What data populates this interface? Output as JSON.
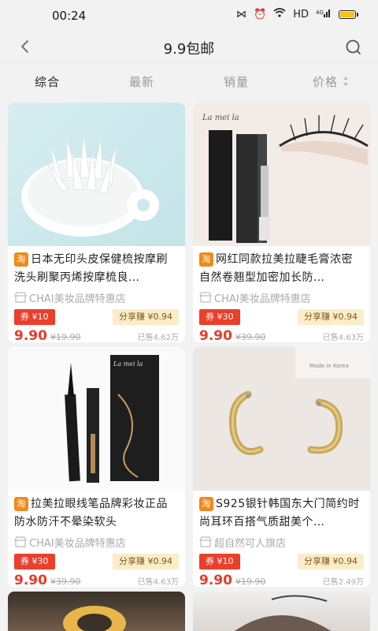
{
  "status": {
    "time": "00:24",
    "network": "HD",
    "signal": "4G"
  },
  "nav": {
    "title": "9.9包邮"
  },
  "tabs": [
    {
      "label": "综合",
      "active": true
    },
    {
      "label": "最新",
      "active": false
    },
    {
      "label": "销量",
      "active": false
    },
    {
      "label": "价格",
      "active": false
    }
  ],
  "products": [
    {
      "platform_badge": "淘",
      "title": "日本无印头皮保健梳按摩刷洗头刷聚丙烯按摩梳良…",
      "shop": "CHAI美妆品牌特惠店",
      "coupon": "券 ¥10",
      "share": "分享赚 ¥0.94",
      "price": "9.90",
      "old_price": "¥19.90",
      "sold": "已售4.62万"
    },
    {
      "platform_badge": "淘",
      "title": "网红同款拉美拉睫毛膏浓密自然卷翘型加密加长防…",
      "shop": "CHAI美妆品牌特惠店",
      "coupon": "券 ¥30",
      "share": "分享赚 ¥0.94",
      "price": "9.90",
      "old_price": "¥39.90",
      "sold": "已售4.63万",
      "image_text": "La mei la"
    },
    {
      "platform_badge": "淘",
      "title": "拉美拉眼线笔品牌彩妆正品防水防汗不晕染软头",
      "shop": "CHAI美妆品牌特惠店",
      "coupon": "券 ¥30",
      "share": "分享赚 ¥0.94",
      "price": "9.90",
      "old_price": "¥39.90",
      "sold": "已售4.63万",
      "image_text": "La mei la"
    },
    {
      "platform_badge": "淘",
      "title": "S925银针韩国东大门简约时尚耳环百搭气质甜美个…",
      "shop": "超自然可人旗店",
      "coupon": "券 ¥10",
      "share": "分享赚 ¥0.94",
      "price": "9.90",
      "old_price": "¥19.90",
      "sold": "已售2.49万",
      "image_text": "Made in Korea"
    }
  ],
  "colors": {
    "accent_red": "#ea3f2b",
    "taobao_orange": "#f08a1a",
    "share_bg": "#fbedc9"
  }
}
